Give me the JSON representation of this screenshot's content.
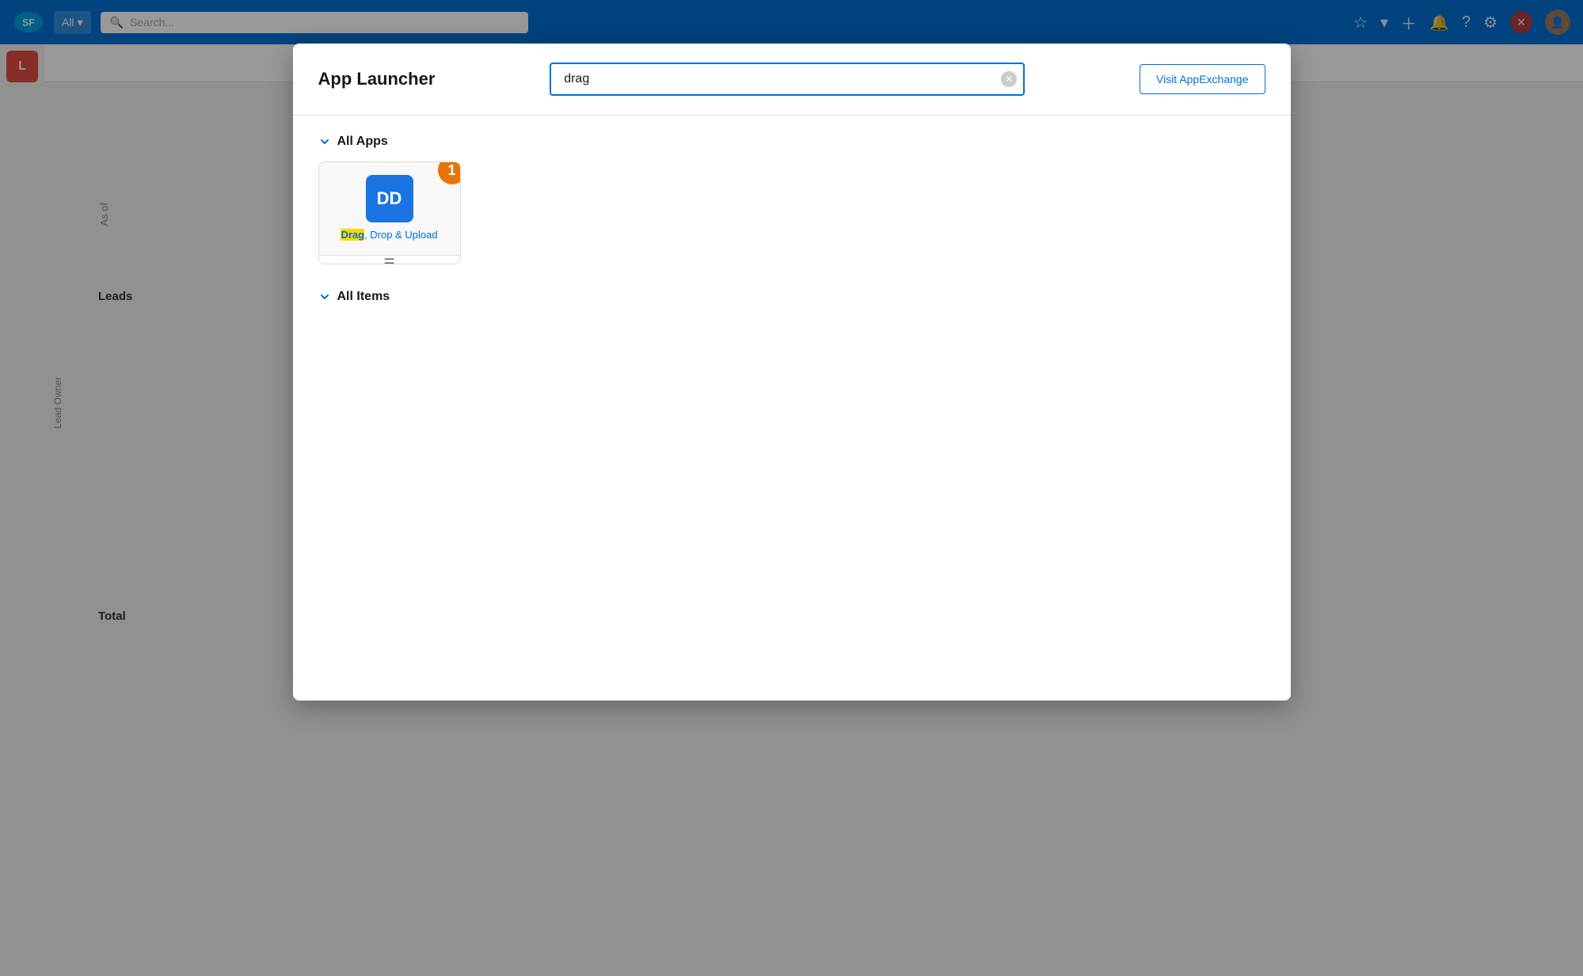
{
  "header": {
    "search_dropdown": "All",
    "search_placeholder": "Search...",
    "icons": [
      "star",
      "dropdown",
      "plus",
      "bell",
      "question",
      "gear",
      "close",
      "avatar"
    ]
  },
  "modal": {
    "title": "App Launcher",
    "search_value": "drag",
    "search_placeholder": "Search...",
    "visit_appexchange_label": "Visit AppExchange",
    "all_apps_label": "All Apps",
    "all_items_label": "All Items",
    "apps": [
      {
        "id": "drag-drop-upload",
        "icon_text": "DD",
        "icon_color": "#1b74e4",
        "name_parts": [
          {
            "text": "Drag",
            "highlight": true
          },
          {
            "text": ", Drop & Upload",
            "highlight": false
          }
        ],
        "name_display": "Drag, Drop & Upload",
        "badge": "1",
        "badge_color": "#e8730a"
      }
    ]
  },
  "background": {
    "as_of_label": "As of",
    "leads_label": "Leads",
    "lead_owner_label": "Lead Owner",
    "total_label": "Total",
    "all_items_section_label": "All Items"
  }
}
